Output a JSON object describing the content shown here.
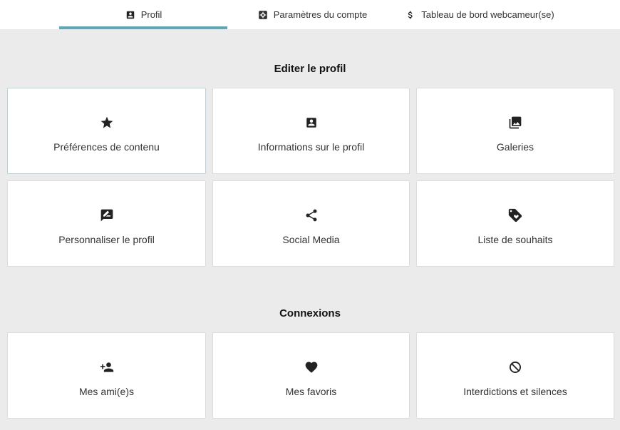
{
  "tabs": [
    {
      "label": "Profil",
      "icon": "account-box-icon",
      "active": true
    },
    {
      "label": "Paramètres du compte",
      "icon": "settings-box-icon",
      "active": false
    },
    {
      "label": "Tableau de bord webcameur(se)",
      "icon": "dollar-icon",
      "active": false
    }
  ],
  "sections": {
    "edit": {
      "title": "Editer le profil",
      "cards": [
        {
          "label": "Préférences de contenu",
          "icon": "star-icon"
        },
        {
          "label": "Informations sur le profil",
          "icon": "account-box-icon"
        },
        {
          "label": "Galeries",
          "icon": "photo-library-icon"
        },
        {
          "label": "Personnaliser le profil",
          "icon": "rate-review-icon"
        },
        {
          "label": "Social Media",
          "icon": "share-icon"
        },
        {
          "label": "Liste de souhaits",
          "icon": "tag-heart-icon"
        }
      ]
    },
    "connections": {
      "title": "Connexions",
      "cards": [
        {
          "label": "Mes ami(e)s",
          "icon": "person-add-icon"
        },
        {
          "label": "Mes favoris",
          "icon": "heart-icon"
        },
        {
          "label": "Interdictions et silences",
          "icon": "block-icon"
        }
      ]
    }
  },
  "colors": {
    "accent": "#5ba8b8",
    "background": "#ebebeb",
    "card": "#ffffff"
  }
}
